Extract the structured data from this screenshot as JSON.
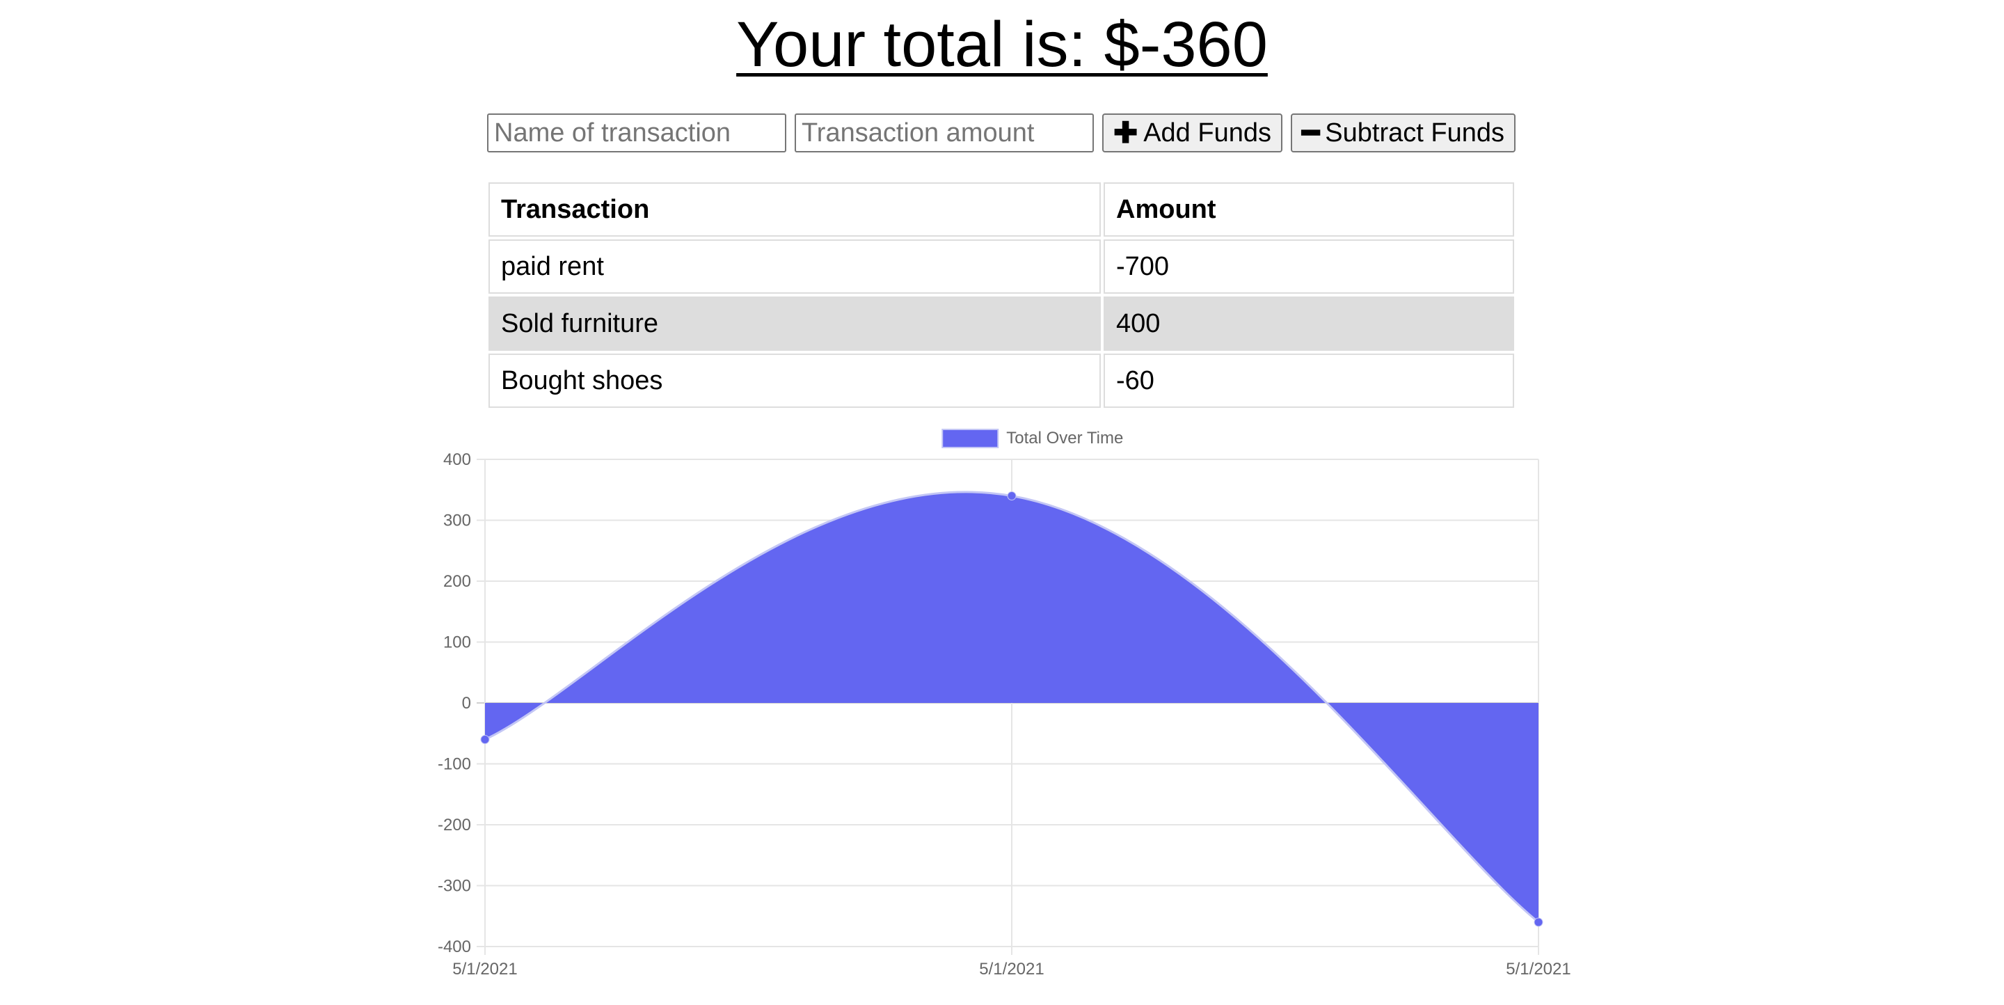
{
  "header": {
    "total_text": "Your total is: $-360"
  },
  "form": {
    "name_placeholder": "Name of transaction",
    "amount_placeholder": "Transaction amount",
    "add_label": "Add Funds",
    "add_icon": "plus-icon",
    "subtract_label": "Subtract Funds",
    "subtract_icon": "minus-icon"
  },
  "table": {
    "headers": [
      "Transaction",
      "Amount"
    ],
    "rows": [
      {
        "name": "paid rent",
        "amount": "-700"
      },
      {
        "name": "Sold furniture",
        "amount": "400"
      },
      {
        "name": "Bought shoes",
        "amount": "-60"
      }
    ]
  },
  "colors": {
    "fill": "#6366f1",
    "stroke": "#c3c6f5",
    "grid": "#e5e5e5",
    "alt_row": "#dddddd"
  },
  "chart_data": {
    "type": "area",
    "x": [
      "5/1/2021",
      "5/1/2021",
      "5/1/2021"
    ],
    "series": [
      {
        "name": "Total Over Time",
        "values": [
          -60,
          340,
          -360
        ]
      }
    ],
    "ylim": [
      -400,
      400
    ],
    "yticks": [
      400,
      300,
      200,
      100,
      0,
      -100,
      -200,
      -300,
      -400
    ],
    "legend": "top-center",
    "grid": true
  }
}
